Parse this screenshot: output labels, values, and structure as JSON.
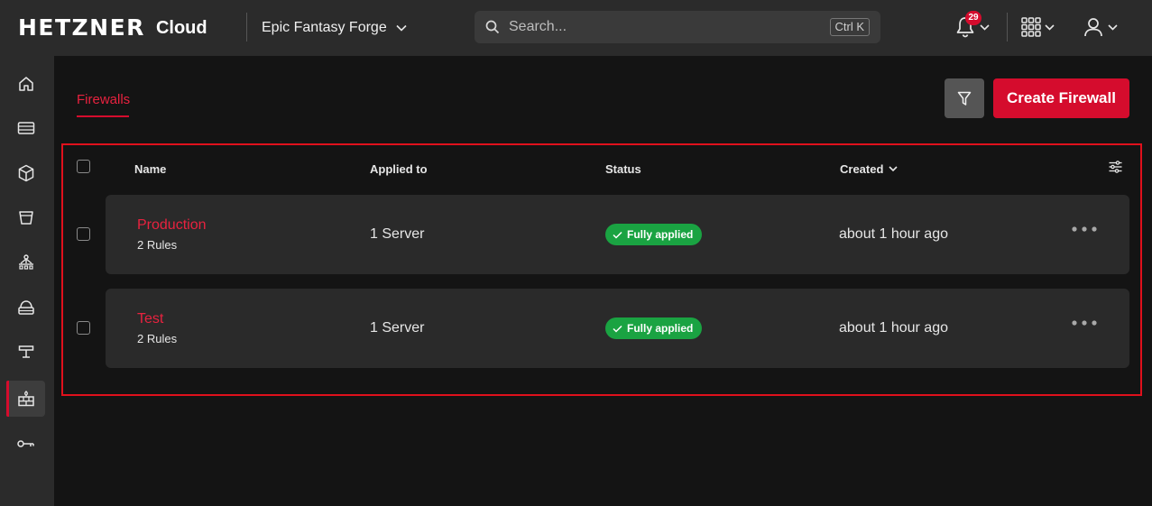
{
  "topbar": {
    "logo": "HETZNER",
    "product": "Cloud",
    "project": "Epic Fantasy Forge",
    "search_placeholder": "Search...",
    "search_shortcut": "Ctrl K",
    "notification_count": "29"
  },
  "sidebar": {
    "items": [
      {
        "icon": "home-icon"
      },
      {
        "icon": "servers-icon"
      },
      {
        "icon": "box-icon"
      },
      {
        "icon": "bucket-icon"
      },
      {
        "icon": "load-balancer-icon"
      },
      {
        "icon": "volume-icon"
      },
      {
        "icon": "network-icon"
      },
      {
        "icon": "firewall-icon",
        "active": true
      },
      {
        "icon": "key-icon"
      }
    ]
  },
  "main": {
    "tab_label": "Firewalls",
    "create_label": "Create Firewall",
    "columns": {
      "name": "Name",
      "applied": "Applied to",
      "status": "Status",
      "created": "Created"
    },
    "rows": [
      {
        "name": "Production",
        "rules": "2 Rules",
        "applied": "1 Server",
        "status": "Fully applied",
        "created": "about 1 hour ago"
      },
      {
        "name": "Test",
        "rules": "2 Rules",
        "applied": "1 Server",
        "status": "Fully applied",
        "created": "about 1 hour ago"
      }
    ]
  },
  "colors": {
    "accent": "#d50c2d",
    "success": "#1aa342",
    "highlight_border": "#e0101c"
  }
}
